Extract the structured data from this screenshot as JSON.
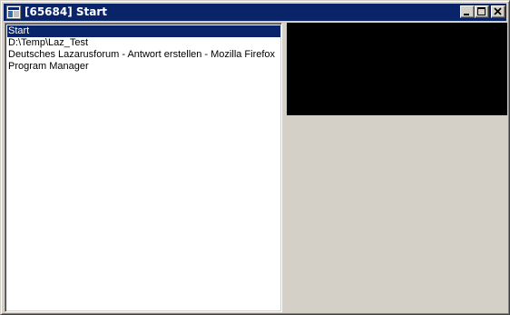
{
  "window": {
    "title": "[65684] Start",
    "caption_buttons": {
      "minimize_icon": "minimize-icon",
      "maximize_icon": "maximize-icon",
      "close_icon": "close-icon"
    }
  },
  "window_list": {
    "selected_index": 0,
    "items": [
      {
        "label": "Start"
      },
      {
        "label": "D:\\Temp\\Laz_Test"
      },
      {
        "label": "Deutsches Lazarusforum - Antwort erstellen - Mozilla Firefox"
      },
      {
        "label": "Program Manager"
      }
    ]
  },
  "preview": {
    "background": "#000000"
  },
  "colors": {
    "titlebar": "#0a246a",
    "face": "#d4d0c8",
    "selection": "#0a246a"
  }
}
